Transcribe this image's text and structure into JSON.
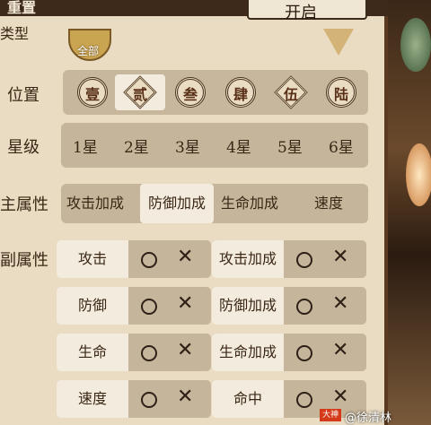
{
  "header": {
    "title": "重置",
    "button_label": "开启"
  },
  "type_row": {
    "label": "类型",
    "badge_label": "全部"
  },
  "position": {
    "label": "位置",
    "items": [
      {
        "glyph": "壹",
        "shape": "circle",
        "selected": false
      },
      {
        "glyph": "贰",
        "shape": "diamond",
        "selected": true
      },
      {
        "glyph": "叁",
        "shape": "circle",
        "selected": false
      },
      {
        "glyph": "肆",
        "shape": "circle",
        "selected": false
      },
      {
        "glyph": "伍",
        "shape": "diamond",
        "selected": false
      },
      {
        "glyph": "陆",
        "shape": "circle",
        "selected": false
      }
    ]
  },
  "stars": {
    "label": "星级",
    "items": [
      "1星",
      "2星",
      "3星",
      "4星",
      "5星",
      "6星"
    ]
  },
  "main_attr": {
    "label": "主属性",
    "items": [
      "攻击加成",
      "防御加成",
      "生命加成",
      "速度"
    ],
    "selected_index": 1
  },
  "sub_attr": {
    "label": "副属性",
    "left": [
      "攻击",
      "防御",
      "生命",
      "速度"
    ],
    "right": [
      "攻击加成",
      "防御加成",
      "生命加成",
      "命中"
    ],
    "circle_symbol": "",
    "x_symbol": "✕"
  },
  "watermark": {
    "tag": "大神",
    "text": "@徐清林"
  },
  "colors": {
    "panel": "#e9dcc2",
    "bar": "#c5b59a",
    "selected": "#f3ebdd",
    "text": "#3a2716"
  }
}
